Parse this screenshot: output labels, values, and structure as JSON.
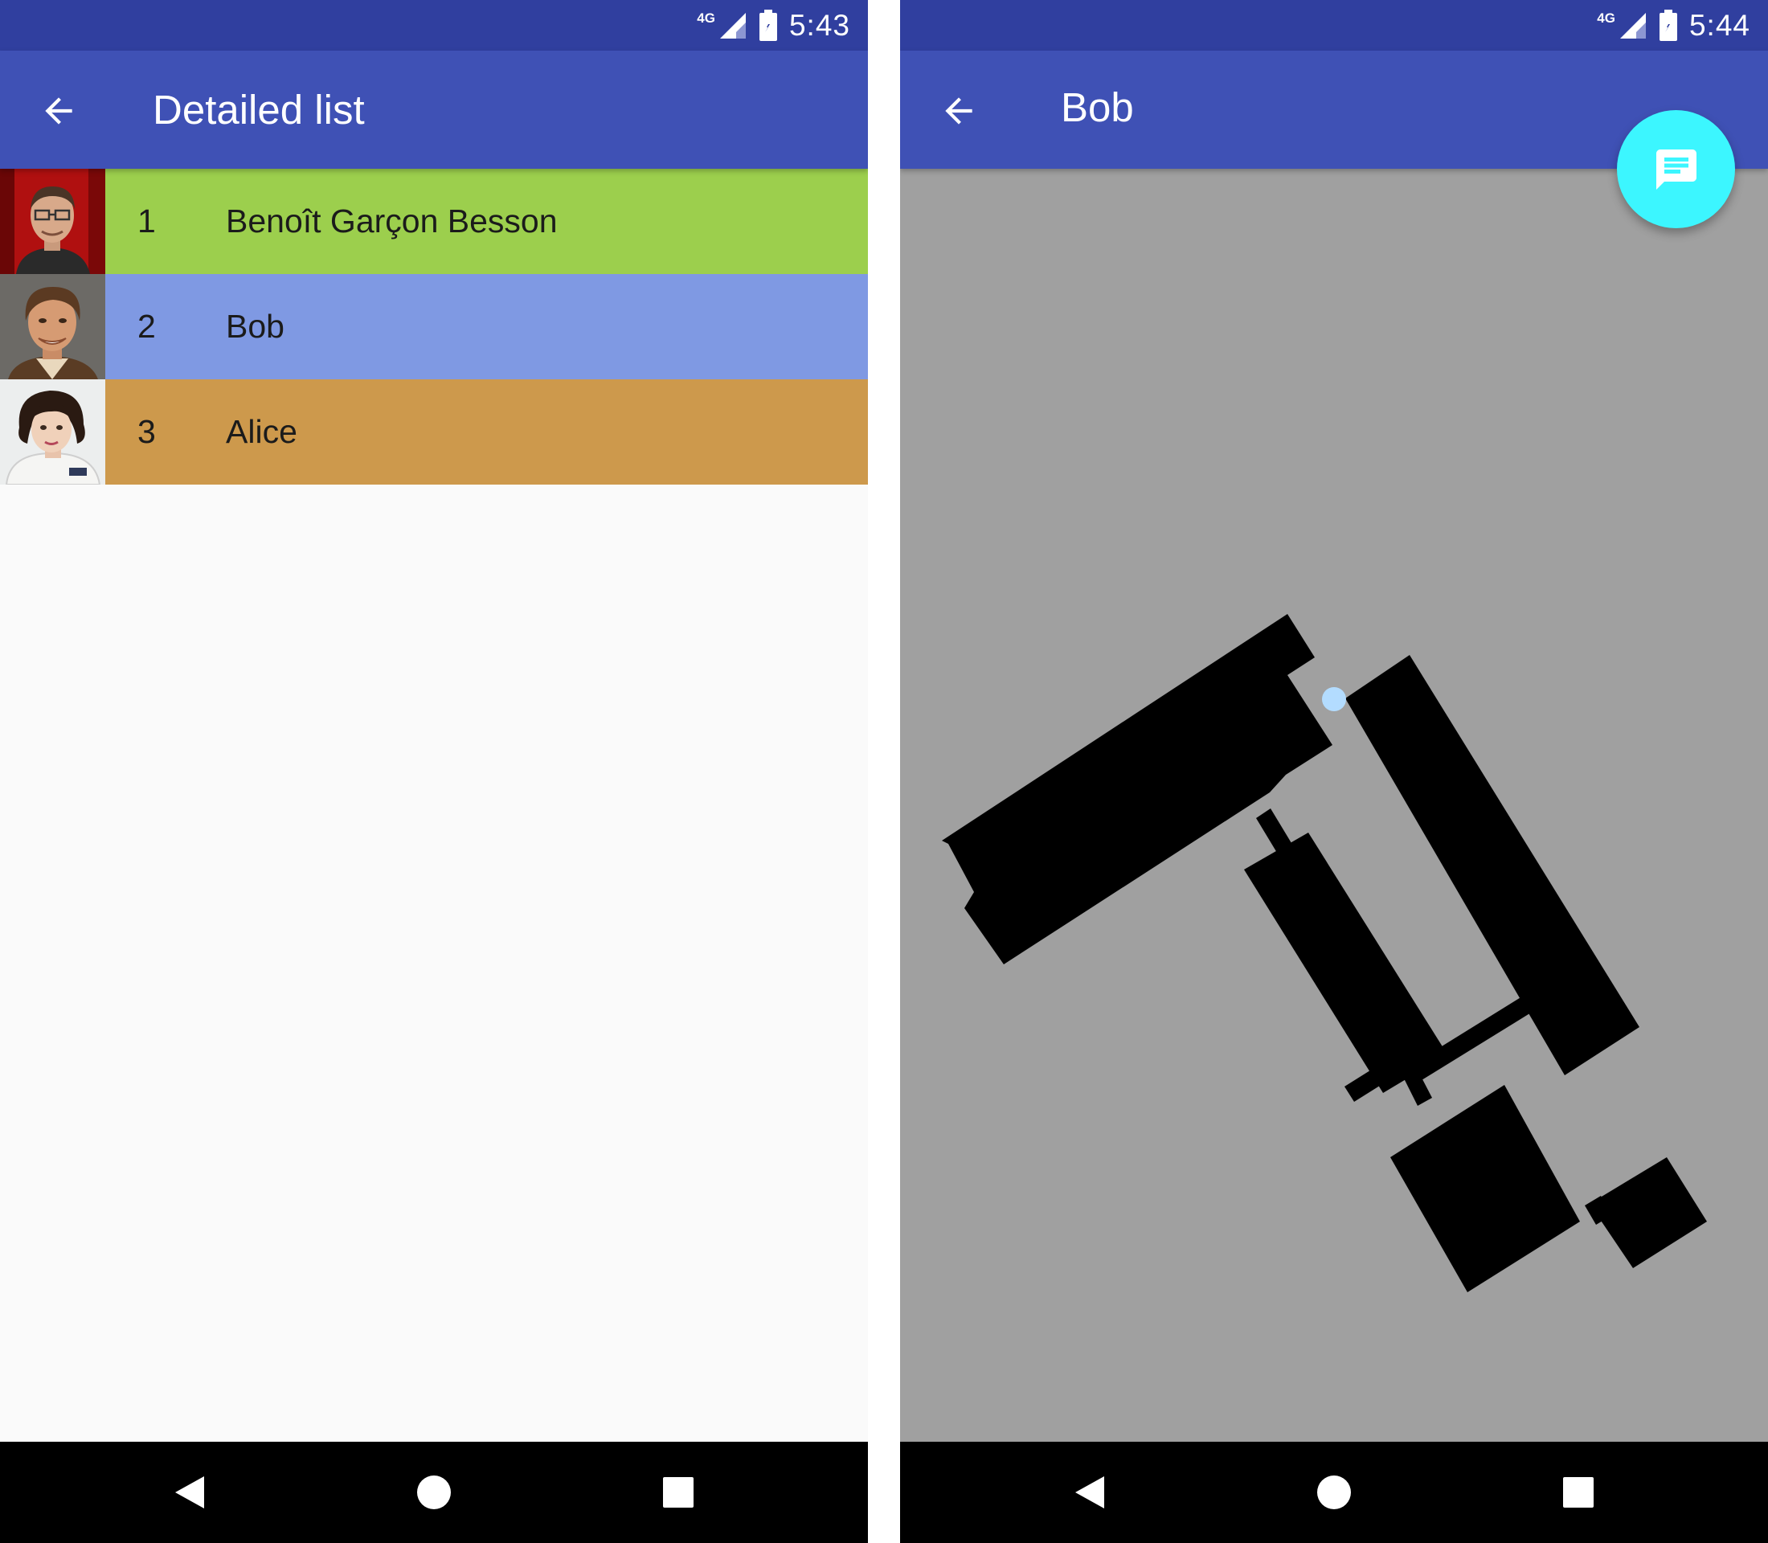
{
  "left_screen": {
    "status_bar": {
      "network": "4G",
      "time": "5:43"
    },
    "toolbar": {
      "title": "Detailed list",
      "back_icon": "arrow-back-icon"
    },
    "list": [
      {
        "number": "1",
        "name": "Benoît Garçon Besson",
        "color": "#9ccf4d",
        "avatar": "man-with-glasses-photo"
      },
      {
        "number": "2",
        "name": "Bob",
        "color": "#7f99e3",
        "avatar": "smiling-man-photo"
      },
      {
        "number": "3",
        "name": "Alice",
        "color": "#cd994c",
        "avatar": "woman-white-jacket-photo"
      }
    ],
    "nav": {
      "back": "nav-back-icon",
      "home": "nav-home-icon",
      "recents": "nav-recents-icon"
    }
  },
  "right_screen": {
    "status_bar": {
      "network": "4G",
      "time": "5:44"
    },
    "toolbar": {
      "title": "Bob",
      "back_icon": "arrow-back-icon"
    },
    "fab": {
      "icon": "message-icon",
      "color": "#3cf6ff"
    },
    "map": {
      "background": "#a0a0a0",
      "building_color": "#000000",
      "marker_color": "#b3dcff"
    },
    "nav": {
      "back": "nav-back-icon",
      "home": "nav-home-icon",
      "recents": "nav-recents-icon"
    }
  }
}
